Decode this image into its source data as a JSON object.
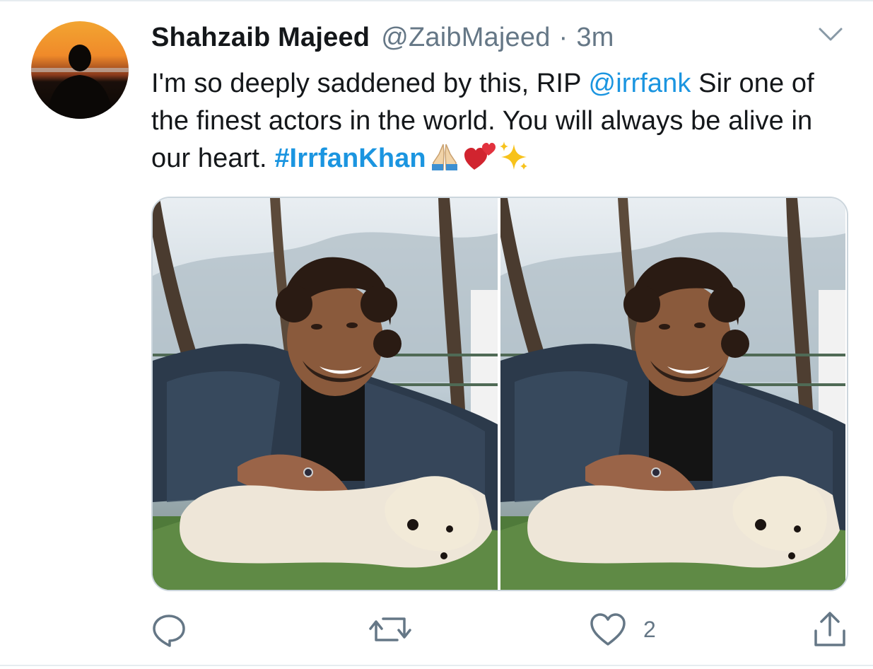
{
  "tweet": {
    "display_name": "Shahzaib Majeed",
    "handle": "@ZaibMajeed",
    "separator": "·",
    "time": "3m",
    "text_1": "I'm so deeply saddened by this, RIP ",
    "mention": "@irrfank",
    "text_2": " Sir one of the finest actors in the world. You will always be alive in our heart. ",
    "hashtag": "#IrrfanKhan",
    "emojis": [
      "folded-hands-emoji",
      "two-hearts-emoji",
      "sparkles-emoji"
    ]
  },
  "actions": {
    "reply_icon": "reply-icon",
    "retweet_icon": "retweet-icon",
    "like_icon": "heart-icon",
    "like_count": "2",
    "share_icon": "share-icon"
  },
  "colors": {
    "link": "#1b95e0",
    "secondary_text": "#657786",
    "primary_text": "#14171a",
    "border": "#ccd6dd"
  }
}
